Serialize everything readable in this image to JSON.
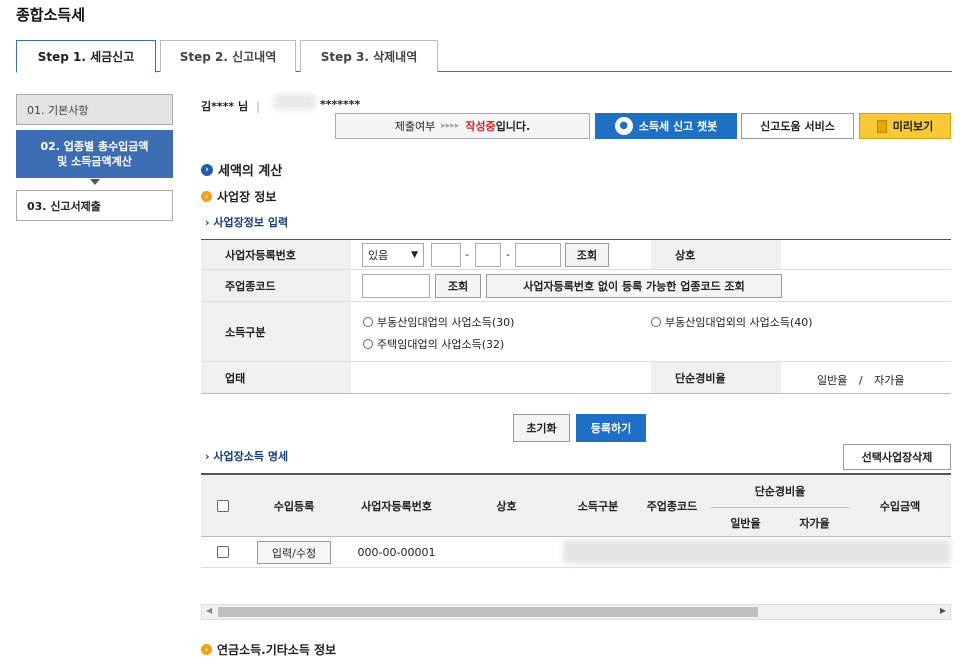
{
  "page_title": "종합소득세",
  "tabs": [
    {
      "label": "Step 1. 세금신고"
    },
    {
      "label": "Step 2. 신고내역"
    },
    {
      "label": "Step 3. 삭제내역"
    }
  ],
  "sidebar": {
    "items": [
      {
        "label": "01. 기본사항"
      },
      {
        "label_line1": "02. 업종별 총수입금액",
        "label_line2": "및 소득금액계산"
      },
      {
        "label": "03. 신고서제출"
      }
    ]
  },
  "user": {
    "name": "김**** 님",
    "separator": "|",
    "id_masked": "*******"
  },
  "status": {
    "prefix": "제출여부",
    "arrows": "▸▸▸▸",
    "highlight": "작성중",
    "suffix": "입니다."
  },
  "toolbar": {
    "chatbot_label": "소득세 신고 챗봇",
    "help_label": "신고도움 서비스",
    "preview_label": "미리보기"
  },
  "sections": {
    "tax_calc": "세액의 계산",
    "business_info": "사업장 정보",
    "business_input": "사업장정보 입력",
    "business_income_list": "사업장소득 명세",
    "pension_info": "연금소득.기타소득 정보"
  },
  "form": {
    "bizno_label": "사업자등록번호",
    "bizno_select": "있음",
    "dash": "-",
    "lookup": "조회",
    "company_label": "상호",
    "industry_code_label": "주업종코드",
    "industry_code_lookup_no_bizno": "사업자등록번호 없이 등록 가능한 업종코드 조회",
    "income_type_label": "소득구분",
    "income_options": [
      "부동산임대업의 사업소득(30)",
      "부동산임대업외의 사업소득(40)",
      "주택임대업의 사업소득(32)"
    ],
    "business_type_label": "업태",
    "simple_rate_label": "단순경비율",
    "general_rate": "일반율",
    "slash": "/",
    "own_rate": "자가율"
  },
  "actions": {
    "reset": "초기화",
    "register": "등록하기",
    "delete_selected": "선택사업장삭제"
  },
  "list": {
    "headers": {
      "income_register": "수입등록",
      "bizno": "사업자등록번호",
      "company": "상호",
      "income_type": "소득구분",
      "industry_code": "주업종코드",
      "simple_rate": "단순경비율",
      "general_rate": "일반율",
      "own_rate": "자가율",
      "revenue": "수입금액"
    },
    "rows": [
      {
        "edit_button": "입력/수정",
        "bizno": "000-00-00001"
      }
    ]
  },
  "colors": {
    "accent": "#1f6fc4",
    "sidebar_active": "#3d6db3",
    "status_red": "#d2232a",
    "preview_yellow": "#f7c93a"
  }
}
